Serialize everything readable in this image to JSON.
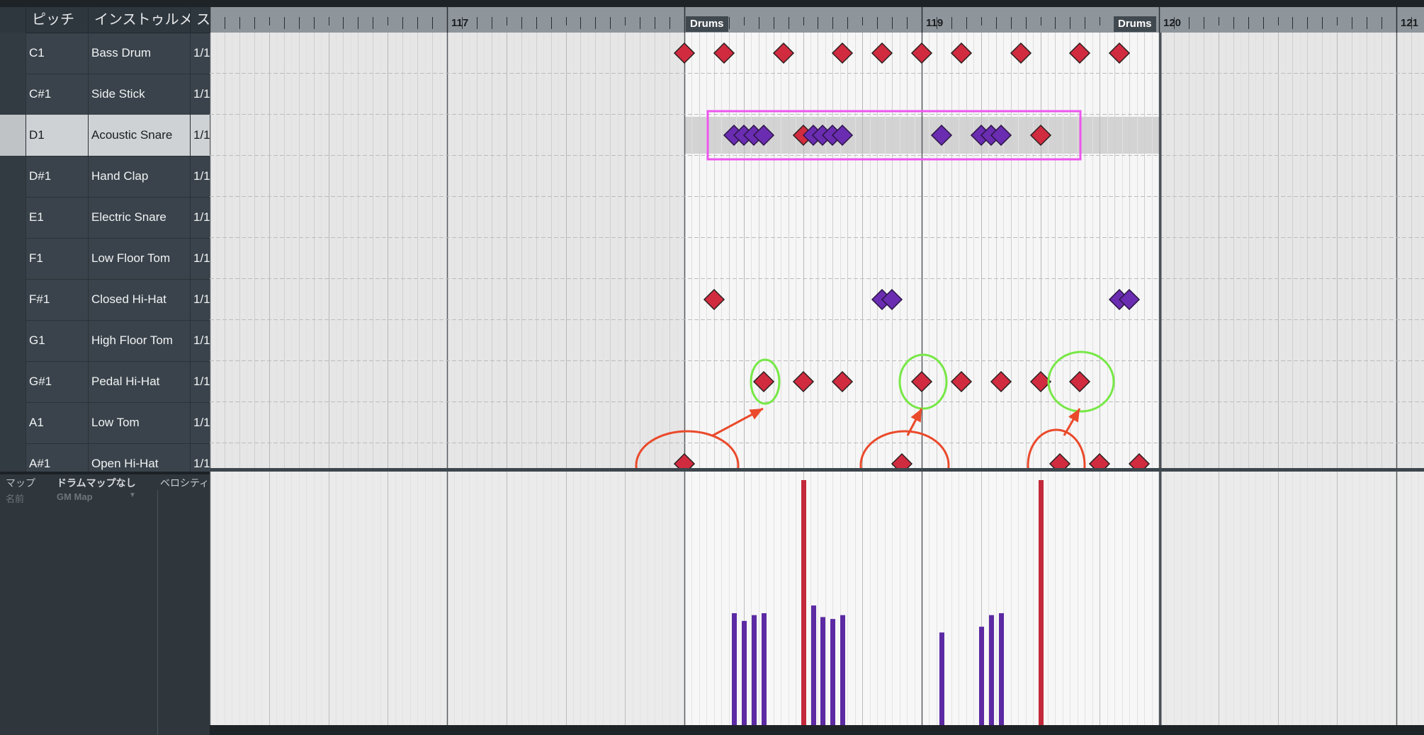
{
  "list": {
    "headers": [
      "ピッチ",
      "インストゥルメ",
      "ス"
    ],
    "rows": [
      {
        "pitch": "C1",
        "instrument": "Bass Drum",
        "q": "1/1"
      },
      {
        "pitch": "C#1",
        "instrument": "Side Stick",
        "q": "1/1"
      },
      {
        "pitch": "D1",
        "instrument": "Acoustic Snare",
        "q": "1/1",
        "selected": true
      },
      {
        "pitch": "D#1",
        "instrument": "Hand Clap",
        "q": "1/1"
      },
      {
        "pitch": "E1",
        "instrument": "Electric Snare",
        "q": "1/1"
      },
      {
        "pitch": "F1",
        "instrument": "Low Floor Tom",
        "q": "1/1"
      },
      {
        "pitch": "F#1",
        "instrument": "Closed Hi-Hat",
        "q": "1/1"
      },
      {
        "pitch": "G1",
        "instrument": "High Floor Tom",
        "q": "1/1"
      },
      {
        "pitch": "G#1",
        "instrument": "Pedal Hi-Hat",
        "q": "1/1"
      },
      {
        "pitch": "A1",
        "instrument": "Low Tom",
        "q": "1/1"
      },
      {
        "pitch": "A#1",
        "instrument": "Open Hi-Hat",
        "q": "1/1"
      }
    ]
  },
  "map_panel": {
    "map_label": "マップ",
    "map_value": "ドラムマップなし",
    "velocity_label": "ベロシティ",
    "name_label": "名前",
    "name_value": "GM Map",
    "dropdown_icon": "chevron-down-icon"
  },
  "ruler": {
    "bars": [
      "117",
      "119",
      "120",
      "121"
    ],
    "part_labels": [
      "Drums",
      "Drums"
    ]
  },
  "timeline": {
    "visible_start_bar": 116,
    "visible_end_bar": 121.2,
    "part_start_bar": 118,
    "part_end_bar": 120
  },
  "notes": [
    {
      "row": 0,
      "beat": 118.0,
      "color": "red"
    },
    {
      "row": 0,
      "beat": 118.167,
      "color": "red"
    },
    {
      "row": 0,
      "beat": 118.417,
      "color": "red"
    },
    {
      "row": 0,
      "beat": 118.667,
      "color": "red"
    },
    {
      "row": 0,
      "beat": 118.833,
      "color": "red"
    },
    {
      "row": 0,
      "beat": 119.0,
      "color": "red"
    },
    {
      "row": 0,
      "beat": 119.167,
      "color": "red"
    },
    {
      "row": 0,
      "beat": 119.417,
      "color": "red"
    },
    {
      "row": 0,
      "beat": 119.667,
      "color": "red"
    },
    {
      "row": 0,
      "beat": 119.833,
      "color": "red"
    },
    {
      "row": 2,
      "beat": 118.208,
      "color": "purple"
    },
    {
      "row": 2,
      "beat": 118.25,
      "color": "purple"
    },
    {
      "row": 2,
      "beat": 118.292,
      "color": "purple"
    },
    {
      "row": 2,
      "beat": 118.333,
      "color": "purple"
    },
    {
      "row": 2,
      "beat": 118.5,
      "color": "red"
    },
    {
      "row": 2,
      "beat": 118.542,
      "color": "purple"
    },
    {
      "row": 2,
      "beat": 118.583,
      "color": "purple"
    },
    {
      "row": 2,
      "beat": 118.625,
      "color": "purple"
    },
    {
      "row": 2,
      "beat": 118.667,
      "color": "purple"
    },
    {
      "row": 2,
      "beat": 119.083,
      "color": "purple"
    },
    {
      "row": 2,
      "beat": 119.25,
      "color": "purple"
    },
    {
      "row": 2,
      "beat": 119.292,
      "color": "purple"
    },
    {
      "row": 2,
      "beat": 119.333,
      "color": "purple"
    },
    {
      "row": 2,
      "beat": 119.5,
      "color": "red"
    },
    {
      "row": 6,
      "beat": 118.125,
      "color": "red"
    },
    {
      "row": 6,
      "beat": 118.833,
      "color": "purple"
    },
    {
      "row": 6,
      "beat": 118.875,
      "color": "purple"
    },
    {
      "row": 6,
      "beat": 119.833,
      "color": "purple"
    },
    {
      "row": 6,
      "beat": 119.875,
      "color": "purple"
    },
    {
      "row": 8,
      "beat": 118.333,
      "color": "red"
    },
    {
      "row": 8,
      "beat": 118.5,
      "color": "red"
    },
    {
      "row": 8,
      "beat": 118.667,
      "color": "red"
    },
    {
      "row": 8,
      "beat": 119.0,
      "color": "red"
    },
    {
      "row": 8,
      "beat": 119.167,
      "color": "red"
    },
    {
      "row": 8,
      "beat": 119.333,
      "color": "red"
    },
    {
      "row": 8,
      "beat": 119.5,
      "color": "red"
    },
    {
      "row": 8,
      "beat": 119.667,
      "color": "red"
    },
    {
      "row": 10,
      "beat": 118.0,
      "color": "red"
    },
    {
      "row": 10,
      "beat": 118.917,
      "color": "red"
    },
    {
      "row": 10,
      "beat": 119.583,
      "color": "red"
    },
    {
      "row": 10,
      "beat": 119.75,
      "color": "red"
    },
    {
      "row": 10,
      "beat": 119.917,
      "color": "red"
    }
  ],
  "velocity_lane": {
    "max": 127,
    "bars": [
      {
        "beat": 118.208,
        "value": 58,
        "color": "purple"
      },
      {
        "beat": 118.25,
        "value": 54,
        "color": "purple"
      },
      {
        "beat": 118.292,
        "value": 57,
        "color": "purple"
      },
      {
        "beat": 118.333,
        "value": 58,
        "color": "purple"
      },
      {
        "beat": 118.5,
        "value": 127,
        "color": "red"
      },
      {
        "beat": 118.542,
        "value": 62,
        "color": "purple"
      },
      {
        "beat": 118.583,
        "value": 56,
        "color": "purple"
      },
      {
        "beat": 118.625,
        "value": 55,
        "color": "purple"
      },
      {
        "beat": 118.667,
        "value": 57,
        "color": "purple"
      },
      {
        "beat": 119.083,
        "value": 48,
        "color": "purple"
      },
      {
        "beat": 119.25,
        "value": 51,
        "color": "purple"
      },
      {
        "beat": 119.292,
        "value": 57,
        "color": "purple"
      },
      {
        "beat": 119.333,
        "value": 58,
        "color": "purple"
      },
      {
        "beat": 119.5,
        "value": 127,
        "color": "red"
      }
    ]
  },
  "annotations": {
    "selection_rect": {
      "row": 2,
      "start_beat": 118.1,
      "end_beat": 119.67,
      "color": "#ee55ee"
    },
    "red_ellipses": [
      {
        "row": 10,
        "beat": 118.0
      },
      {
        "row": 10,
        "beat": 118.917
      },
      {
        "row": 10,
        "beat": 119.583
      }
    ],
    "green_ellipses": [
      {
        "row": 8,
        "beat": 118.333
      },
      {
        "row": 8,
        "beat": 119.0
      },
      {
        "row": 8,
        "beat": 119.667
      }
    ],
    "arrows": [
      {
        "from_row": 10,
        "from_beat": 118.12,
        "to_row": 8,
        "to_beat": 118.33
      },
      {
        "from_row": 10,
        "from_beat": 118.94,
        "to_row": 8,
        "to_beat": 119.0
      },
      {
        "from_row": 10,
        "from_beat": 119.6,
        "to_row": 8,
        "to_beat": 119.667
      }
    ],
    "red_color": "#ea4a2b",
    "green_color": "#77e846"
  },
  "colors": {
    "note_red": "#d12b3f",
    "note_purple": "#6a2cb0",
    "grid_bg": "#f5f5f5",
    "selected_row": "#cfd2d4"
  }
}
